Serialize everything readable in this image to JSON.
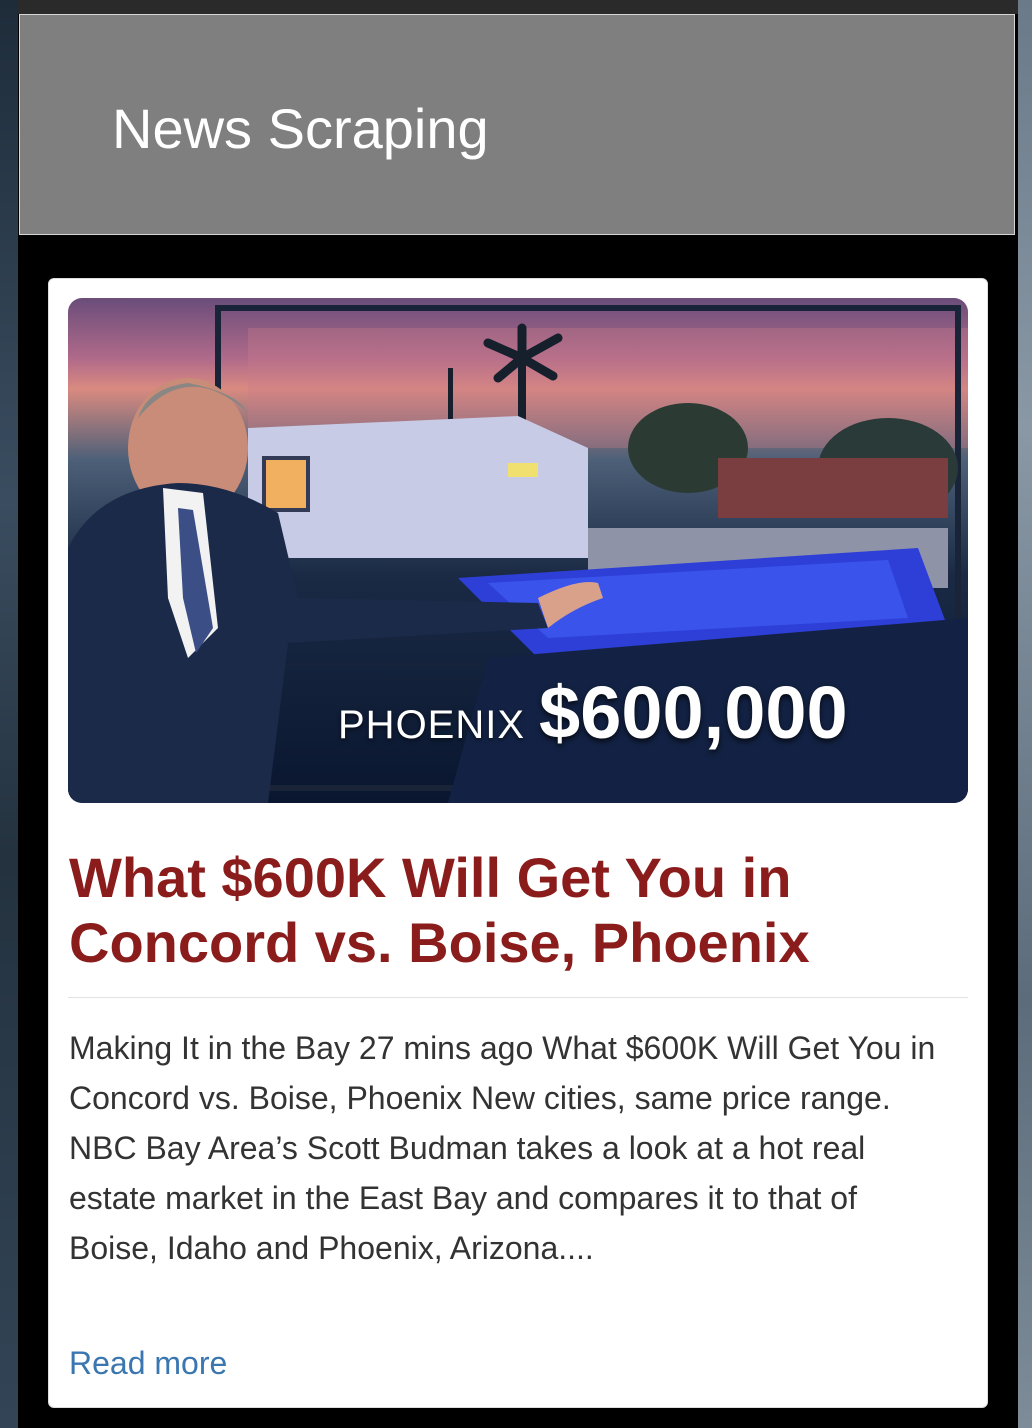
{
  "header": {
    "title": "News Scraping"
  },
  "article": {
    "image": {
      "city": "PHOENIX",
      "price": "$600,000"
    },
    "title": "What $600K Will Get You in Concord vs. Boise, Phoenix",
    "body": "Making It in the Bay 27 mins ago What $600K Will Get You in Concord vs. Boise, Phoenix New cities, same price range. NBC Bay Area’s Scott Budman takes a look at a hot real estate market in the East Bay and compares it to that of Boise, Idaho and Phoenix, Arizona....",
    "read_more": "Read more"
  },
  "colors": {
    "header_bg": "#7f7f7f",
    "title_red": "#8a1c1c",
    "link_blue": "#3a76b0"
  }
}
